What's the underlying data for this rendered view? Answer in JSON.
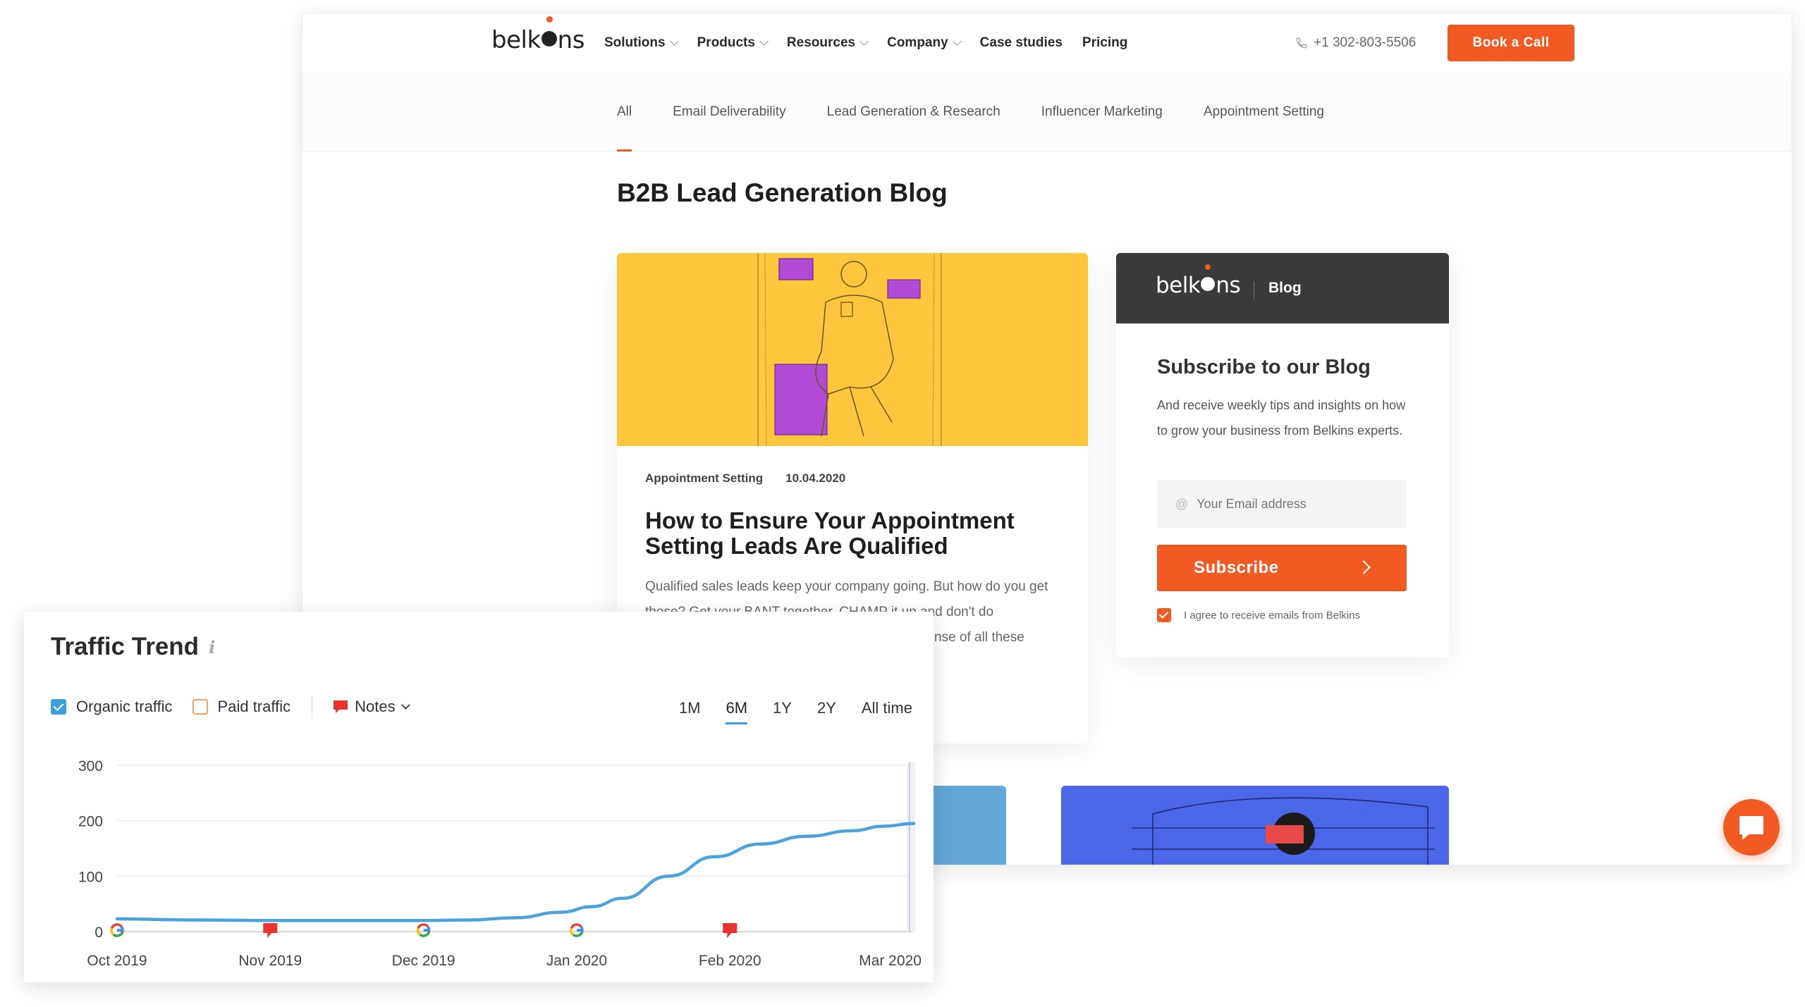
{
  "site": {
    "logo": {
      "pre": "belk",
      "post": "ns"
    },
    "nav": [
      {
        "label": "Solutions",
        "dropdown": true
      },
      {
        "label": "Products",
        "dropdown": true
      },
      {
        "label": "Resources",
        "dropdown": true
      },
      {
        "label": "Company",
        "dropdown": true
      },
      {
        "label": "Case studies",
        "dropdown": false
      },
      {
        "label": "Pricing",
        "dropdown": false
      }
    ],
    "phone": "+1 302-803-5506",
    "cta": "Book a Call",
    "accent": "#f15a22",
    "categories": [
      "All",
      "Email Deliverability",
      "Lead Generation & Research",
      "Influencer Marketing",
      "Appointment Setting"
    ],
    "page_title": "B2B Lead Generation Blog",
    "post": {
      "category": "Appointment Setting",
      "date": "10.04.2020",
      "title": "How to Ensure Your Appointment Setting Leads Are Qualified",
      "excerpt": "Qualified sales leads keep your company going. But how do you get those? Get your BANT together, CHAMP it up and don't do",
      "excerpt_tail": "nse of all these"
    },
    "subscribe": {
      "blog_label": "Blog",
      "title": "Subscribe to our Blog",
      "text": "And receive weekly tips and insights on how to grow your business from Belkins experts.",
      "email_placeholder": "Your Email address",
      "button": "Subscribe",
      "agree": "I agree to receive emails from Belkins"
    }
  },
  "traffic": {
    "title": "Traffic Trend",
    "info": "i",
    "legend": {
      "organic": "Organic traffic",
      "paid": "Paid traffic",
      "notes": "Notes"
    },
    "ranges": [
      "1M",
      "6M",
      "1Y",
      "2Y",
      "All time"
    ],
    "active_range": "6M",
    "line_color": "#4aa3db"
  },
  "chart_data": {
    "type": "line",
    "title": "Traffic Trend",
    "xlabel": "",
    "ylabel": "",
    "categories": [
      "Oct 2019",
      "Nov 2019",
      "Dec 2019",
      "Jan 2020",
      "Feb 2020",
      "Mar 2020"
    ],
    "yticks": [
      0,
      100,
      200,
      300
    ],
    "ylim": [
      0,
      300
    ],
    "xlim": [
      0,
      5.2
    ],
    "grid": true,
    "series": [
      {
        "name": "Organic traffic",
        "x": [
          0,
          0.5,
          1,
          1.5,
          2,
          2.3,
          2.6,
          2.9,
          3.1,
          3.3,
          3.6,
          3.9,
          4.2,
          4.5,
          4.8,
          5.0,
          5.2
        ],
        "y": [
          23,
          21,
          20,
          20,
          20,
          21,
          25,
          35,
          45,
          60,
          100,
          135,
          158,
          172,
          182,
          190,
          195
        ]
      }
    ],
    "markers": [
      {
        "kind": "google",
        "x": 0
      },
      {
        "kind": "note",
        "x": 1
      },
      {
        "kind": "google",
        "x": 2
      },
      {
        "kind": "google",
        "x": 3
      },
      {
        "kind": "note",
        "x": 4
      }
    ]
  }
}
